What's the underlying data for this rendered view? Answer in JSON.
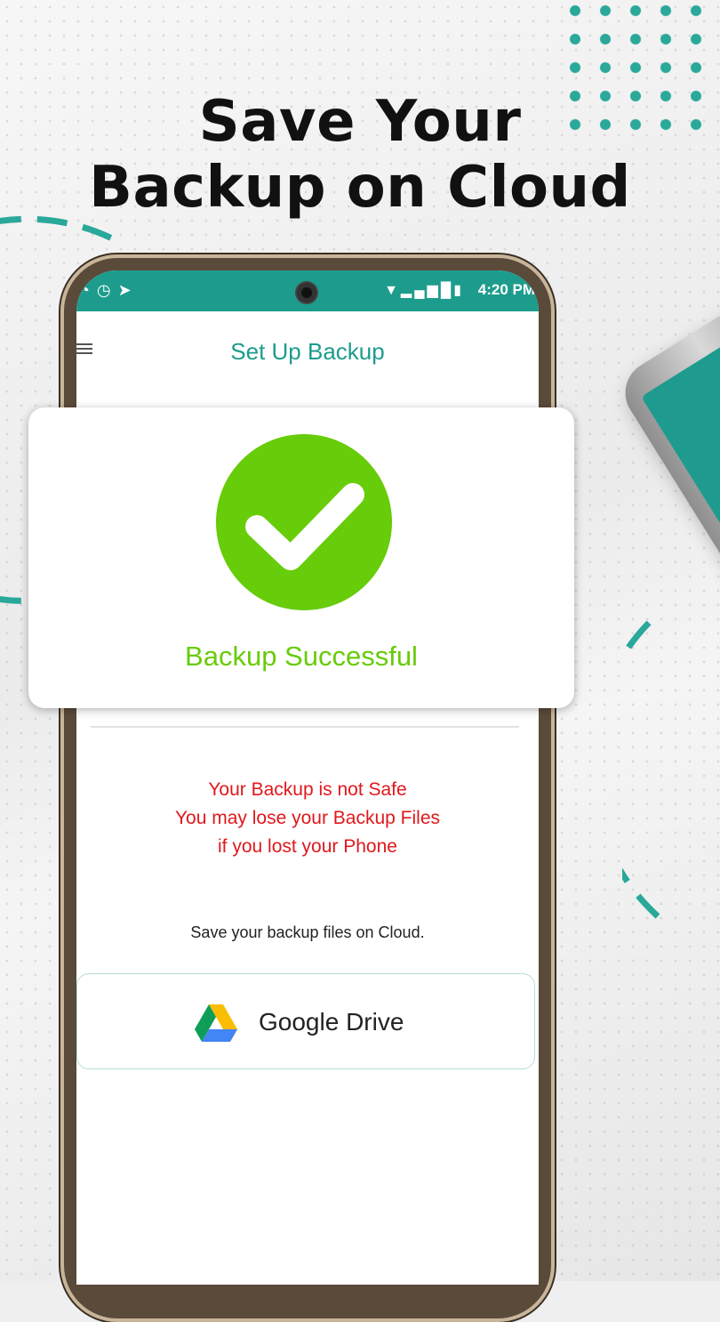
{
  "headline": {
    "line1": "Save Your",
    "line2": "Backup on Cloud"
  },
  "status_bar": {
    "time": "4:20 PM"
  },
  "app_bar": {
    "title": "Set Up Backup"
  },
  "dialog": {
    "message": "Backup Successful"
  },
  "warning": {
    "line1": "Your Backup is not Safe",
    "line2": "You may lose your Backup Files",
    "line3": "if you lost your Phone"
  },
  "cloud_note": "Save your backup files on Cloud.",
  "google_drive_button": {
    "label": "Google Drive",
    "icon": "google-drive-icon"
  },
  "colors": {
    "accent": "#1d9c8d",
    "success": "#67cc09",
    "warning": "#e0181c"
  }
}
